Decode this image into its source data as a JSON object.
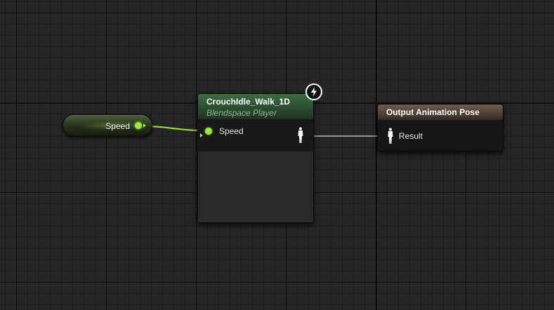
{
  "graph": {
    "variable_node": {
      "label": "Speed",
      "pin_color": "#9be83a"
    },
    "blendspace_node": {
      "title": "CrouchIdle_Walk_1D",
      "subtitle": "Blendspace Player",
      "input_pin": "Speed",
      "header_color": "#3f6d44",
      "icon": "fast-path-icon"
    },
    "output_node": {
      "title": "Output Animation Pose",
      "input_pin": "Result",
      "header_color": "#6e5d4f",
      "icon": "pose-pin-icon"
    }
  }
}
